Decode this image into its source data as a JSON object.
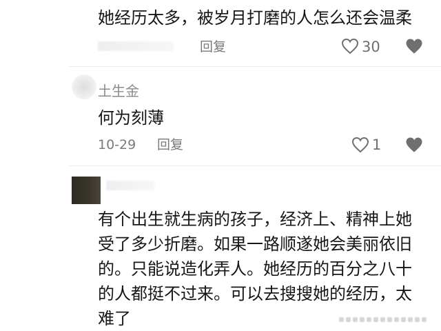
{
  "comments": [
    {
      "text": "她经历太多，被岁月打磨的人怎么还会温柔",
      "reply_label": "回复",
      "likes": "30"
    },
    {
      "username": "土生金",
      "text": "何为刻薄",
      "date": "10-29",
      "reply_label": "回复",
      "likes": "1"
    },
    {
      "lines": [
        "有个出生就生病的孩子，经济上、精神上她",
        "受了多少折磨。如果一路顺遂她会美丽依旧",
        "的。只能说造化弄人。她经历的百分之八十",
        "的人都挺不过来。可以去搜搜她的经历，太",
        "难了"
      ]
    }
  ],
  "icons": {
    "like": "heart-outline-icon",
    "dislike": "broken-heart-icon"
  }
}
